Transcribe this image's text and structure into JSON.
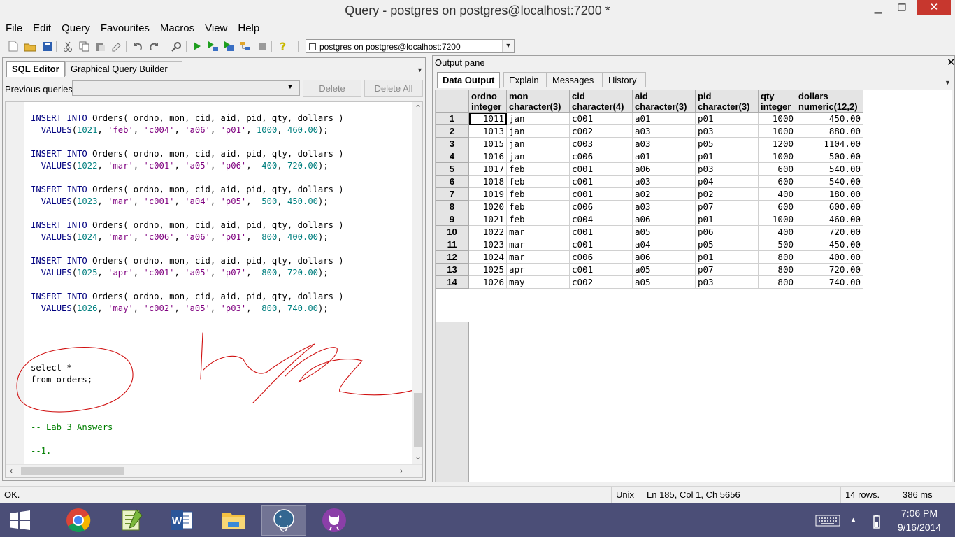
{
  "window": {
    "title": "Query - postgres on postgres@localhost:7200 *",
    "min": "▁",
    "max": "❐",
    "close": "✕"
  },
  "menus": [
    "File",
    "Edit",
    "Query",
    "Favourites",
    "Macros",
    "View",
    "Help"
  ],
  "connection": {
    "value": "postgres on postgres@localhost:7200"
  },
  "editor_tabs": [
    "SQL Editor",
    "Graphical Query Builder"
  ],
  "previous_queries": {
    "label": "Previous queries",
    "value": "",
    "delete": "Delete",
    "delete_all": "Delete All"
  },
  "code_lines": [
    {
      "kind": "insert",
      "ordno": "1021",
      "mon": "'feb'",
      "cid": "'c004'",
      "aid": "'a06'",
      "pid": "'p01'",
      "qty": "1000",
      "dollars": "460.00"
    },
    {
      "kind": "blank"
    },
    {
      "kind": "insert",
      "ordno": "1022",
      "mon": "'mar'",
      "cid": "'c001'",
      "aid": "'a05'",
      "pid": "'p06'",
      "qty": " 400",
      "dollars": "720.00"
    },
    {
      "kind": "blank"
    },
    {
      "kind": "insert",
      "ordno": "1023",
      "mon": "'mar'",
      "cid": "'c001'",
      "aid": "'a04'",
      "pid": "'p05'",
      "qty": " 500",
      "dollars": "450.00"
    },
    {
      "kind": "blank"
    },
    {
      "kind": "insert",
      "ordno": "1024",
      "mon": "'mar'",
      "cid": "'c006'",
      "aid": "'a06'",
      "pid": "'p01'",
      "qty": " 800",
      "dollars": "400.00"
    },
    {
      "kind": "blank"
    },
    {
      "kind": "insert",
      "ordno": "1025",
      "mon": "'apr'",
      "cid": "'c001'",
      "aid": "'a05'",
      "pid": "'p07'",
      "qty": " 800",
      "dollars": "720.00"
    },
    {
      "kind": "blank"
    },
    {
      "kind": "insert",
      "ordno": "1026",
      "mon": "'may'",
      "cid": "'c002'",
      "aid": "'a05'",
      "pid": "'p03'",
      "qty": " 800",
      "dollars": "740.00"
    },
    {
      "kind": "blank"
    },
    {
      "kind": "blank"
    },
    {
      "kind": "blank"
    },
    {
      "kind": "blank"
    },
    {
      "kind": "plain",
      "text": "select *"
    },
    {
      "kind": "plain",
      "text": "from orders;"
    },
    {
      "kind": "blank"
    },
    {
      "kind": "blank"
    },
    {
      "kind": "blank"
    },
    {
      "kind": "comment",
      "text": "-- Lab 3 Answers"
    },
    {
      "kind": "blank"
    },
    {
      "kind": "comment",
      "text": "--1."
    }
  ],
  "sql_text": {
    "insert_head": "INSERT INTO Orders( ordno, mon, cid, aid, pid, qty, dollars )",
    "values_kw": "VALUES"
  },
  "output": {
    "title": "Output pane",
    "close": "✕",
    "tabs": [
      "Data Output",
      "Explain",
      "Messages",
      "History"
    ]
  },
  "grid": {
    "columns": [
      {
        "name": "ordno",
        "type": "integer"
      },
      {
        "name": "mon",
        "type": "character(3)"
      },
      {
        "name": "cid",
        "type": "character(4)"
      },
      {
        "name": "aid",
        "type": "character(3)"
      },
      {
        "name": "pid",
        "type": "character(3)"
      },
      {
        "name": "qty",
        "type": "integer"
      },
      {
        "name": "dollars",
        "type": "numeric(12,2)"
      }
    ],
    "rows": [
      [
        "1011",
        "jan",
        "c001",
        "a01",
        "p01",
        "1000",
        "450.00"
      ],
      [
        "1013",
        "jan",
        "c002",
        "a03",
        "p03",
        "1000",
        "880.00"
      ],
      [
        "1015",
        "jan",
        "c003",
        "a03",
        "p05",
        "1200",
        "1104.00"
      ],
      [
        "1016",
        "jan",
        "c006",
        "a01",
        "p01",
        "1000",
        "500.00"
      ],
      [
        "1017",
        "feb",
        "c001",
        "a06",
        "p03",
        "600",
        "540.00"
      ],
      [
        "1018",
        "feb",
        "c001",
        "a03",
        "p04",
        "600",
        "540.00"
      ],
      [
        "1019",
        "feb",
        "c001",
        "a02",
        "p02",
        "400",
        "180.00"
      ],
      [
        "1020",
        "feb",
        "c006",
        "a03",
        "p07",
        "600",
        "600.00"
      ],
      [
        "1021",
        "feb",
        "c004",
        "a06",
        "p01",
        "1000",
        "460.00"
      ],
      [
        "1022",
        "mar",
        "c001",
        "a05",
        "p06",
        "400",
        "720.00"
      ],
      [
        "1023",
        "mar",
        "c001",
        "a04",
        "p05",
        "500",
        "450.00"
      ],
      [
        "1024",
        "mar",
        "c006",
        "a06",
        "p01",
        "800",
        "400.00"
      ],
      [
        "1025",
        "apr",
        "c001",
        "a05",
        "p07",
        "800",
        "720.00"
      ],
      [
        "1026",
        "may",
        "c002",
        "a05",
        "p03",
        "800",
        "740.00"
      ]
    ]
  },
  "status": {
    "message": "OK.",
    "eol": "Unix",
    "position": "Ln 185, Col 1, Ch 5656",
    "rows": "14 rows.",
    "time": "386 ms"
  },
  "taskbar": {
    "items": [
      "windows-start",
      "chrome",
      "notepad-plus-plus",
      "word",
      "file-explorer",
      "pgadmin",
      "github"
    ],
    "time": "7:06 PM",
    "date": "9/16/2014"
  },
  "colors": {
    "accent_close": "#c7372e",
    "taskbar": "#4b4e77",
    "annotation": "#d01010"
  }
}
